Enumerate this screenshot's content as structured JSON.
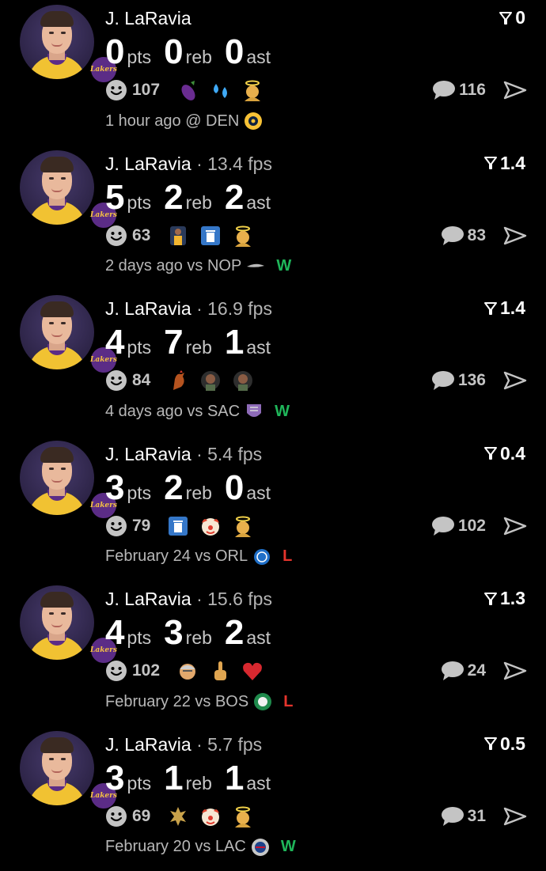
{
  "colors": {
    "background": "#000000",
    "text_primary": "#ffffff",
    "text_secondary": "#b4b4b4",
    "win": "#1fb65a",
    "loss": "#e5342c",
    "lakers_purple": "#5b2c86",
    "lakers_gold": "#f5c242"
  },
  "feed": [
    {
      "player": "J. LaRavia",
      "fps": "",
      "rating": "0",
      "pts": "0",
      "pts_label": "pts",
      "reb": "0",
      "reb_label": "reb",
      "ast": "0",
      "ast_label": "ast",
      "reaction_count": "107",
      "emojis": [
        "eggplant-emoji",
        "sweat-droplets-emoji",
        "angel-emoji"
      ],
      "comment_count": "116",
      "meta": "1 hour ago @ DEN",
      "opponent_logo": "nuggets-logo-icon",
      "result": ""
    },
    {
      "player": "J. LaRavia",
      "fps": "· 13.4 fps",
      "rating": "1.4",
      "pts": "5",
      "pts_label": "pts",
      "reb": "2",
      "reb_label": "reb",
      "ast": "2",
      "ast_label": "ast",
      "reaction_count": "63",
      "emojis": [
        "player-photo-emoji",
        "trash-can-emoji",
        "angel-emoji"
      ],
      "comment_count": "83",
      "meta": "2 days ago vs NOP",
      "opponent_logo": "pelicans-logo-icon",
      "result": "W"
    },
    {
      "player": "J. LaRavia",
      "fps": "· 16.9 fps",
      "rating": "1.4",
      "pts": "4",
      "pts_label": "pts",
      "reb": "7",
      "reb_label": "reb",
      "ast": "1",
      "ast_label": "ast",
      "reaction_count": "84",
      "emojis": [
        "rooster-emoji",
        "player-face-emoji",
        "player-face-emoji"
      ],
      "comment_count": "136",
      "meta": "4 days ago vs SAC",
      "opponent_logo": "kings-logo-icon",
      "result": "W"
    },
    {
      "player": "J. LaRavia",
      "fps": "· 5.4 fps",
      "rating": "0.4",
      "pts": "3",
      "pts_label": "pts",
      "reb": "2",
      "reb_label": "reb",
      "ast": "0",
      "ast_label": "ast",
      "reaction_count": "79",
      "emojis": [
        "trash-can-emoji",
        "clown-emoji",
        "angel-emoji"
      ],
      "comment_count": "102",
      "meta": "February 24 vs ORL",
      "opponent_logo": "magic-logo-icon",
      "result": "L"
    },
    {
      "player": "J. LaRavia",
      "fps": "· 15.6 fps",
      "rating": "1.3",
      "pts": "4",
      "pts_label": "pts",
      "reb": "3",
      "reb_label": "reb",
      "ast": "2",
      "ast_label": "ast",
      "reaction_count": "102",
      "emojis": [
        "old-man-emoji",
        "middle-finger-emoji",
        "red-heart-emoji"
      ],
      "comment_count": "24",
      "meta": "February 22 vs BOS",
      "opponent_logo": "celtics-logo-icon",
      "result": "L"
    },
    {
      "player": "J. LaRavia",
      "fps": "· 5.7 fps",
      "rating": "0.5",
      "pts": "3",
      "pts_label": "pts",
      "reb": "1",
      "reb_label": "reb",
      "ast": "1",
      "ast_label": "ast",
      "reaction_count": "69",
      "emojis": [
        "trident-emblem-emoji",
        "clown-emoji",
        "angel-emoji"
      ],
      "comment_count": "31",
      "meta": "February 20 vs LAC",
      "opponent_logo": "clippers-logo-icon",
      "result": "W"
    }
  ]
}
